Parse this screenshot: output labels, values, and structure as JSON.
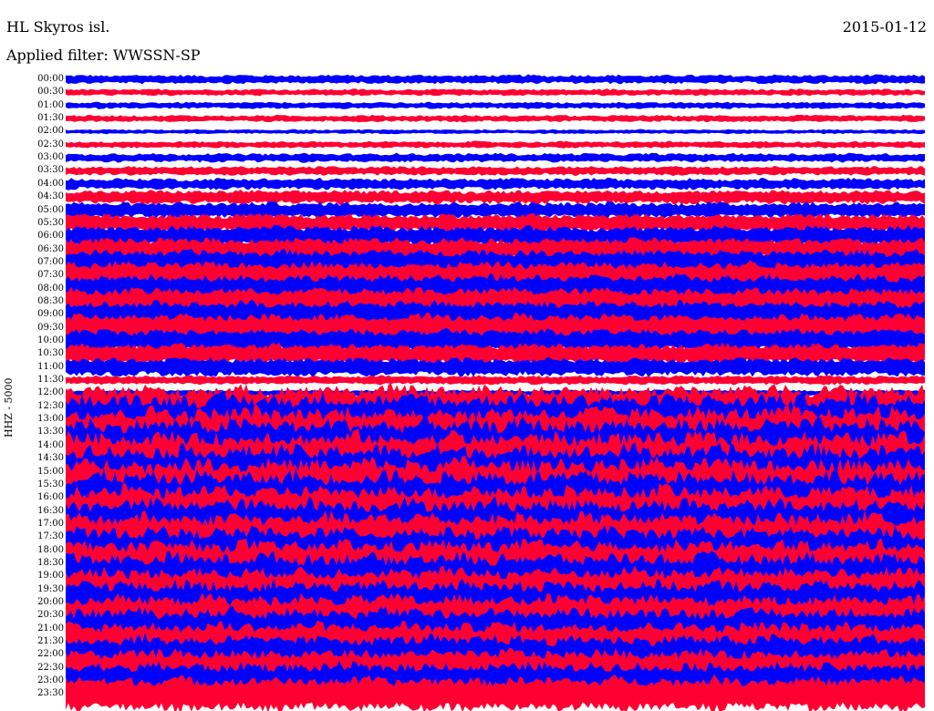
{
  "header": {
    "station": "HL Skyros isl.",
    "date": "2015-01-12",
    "filter": "Applied filter: WWSSN-SP"
  },
  "chart_data": {
    "type": "line",
    "title": "HL Skyros isl.",
    "ylabel": "HHZ - 5000",
    "trace_colors": [
      "#0000ff",
      "#ff0033"
    ],
    "ytick_labels": [
      "00:00",
      "00:30",
      "01:00",
      "01:30",
      "02:00",
      "02:30",
      "03:00",
      "03:30",
      "04:00",
      "04:30",
      "05:00",
      "05:30",
      "06:00",
      "06:30",
      "07:00",
      "07:30",
      "08:00",
      "08:30",
      "09:00",
      "09:30",
      "10:00",
      "10:30",
      "11:00",
      "11:30",
      "12:00",
      "12:30",
      "13:00",
      "13:30",
      "14:00",
      "14:30",
      "15:00",
      "15:30",
      "16:00",
      "16:30",
      "17:00",
      "17:30",
      "18:00",
      "18:30",
      "19:00",
      "19:30",
      "20:00",
      "20:30",
      "21:00",
      "21:30",
      "22:00",
      "22:30",
      "23:00",
      "23:30"
    ],
    "series": [
      {
        "values": [
          0.4,
          0.3,
          0.3,
          0.3,
          0.2,
          0.3,
          0.4,
          0.4,
          0.5,
          0.6,
          0.7,
          0.8,
          0.9,
          1.0,
          1.1,
          1.2,
          1.2,
          1.2,
          1.2,
          1.2,
          1.0,
          0.9,
          0.8,
          0.4,
          0.3,
          1.8,
          2.2,
          2.2,
          2.3,
          2.3,
          2.3,
          2.3,
          2.3,
          2.2,
          2.2,
          2.1,
          2.0,
          2.0,
          2.0,
          1.9,
          1.9,
          1.8,
          1.8,
          1.7,
          1.7,
          1.6,
          1.6,
          1.5
        ]
      }
    ]
  }
}
